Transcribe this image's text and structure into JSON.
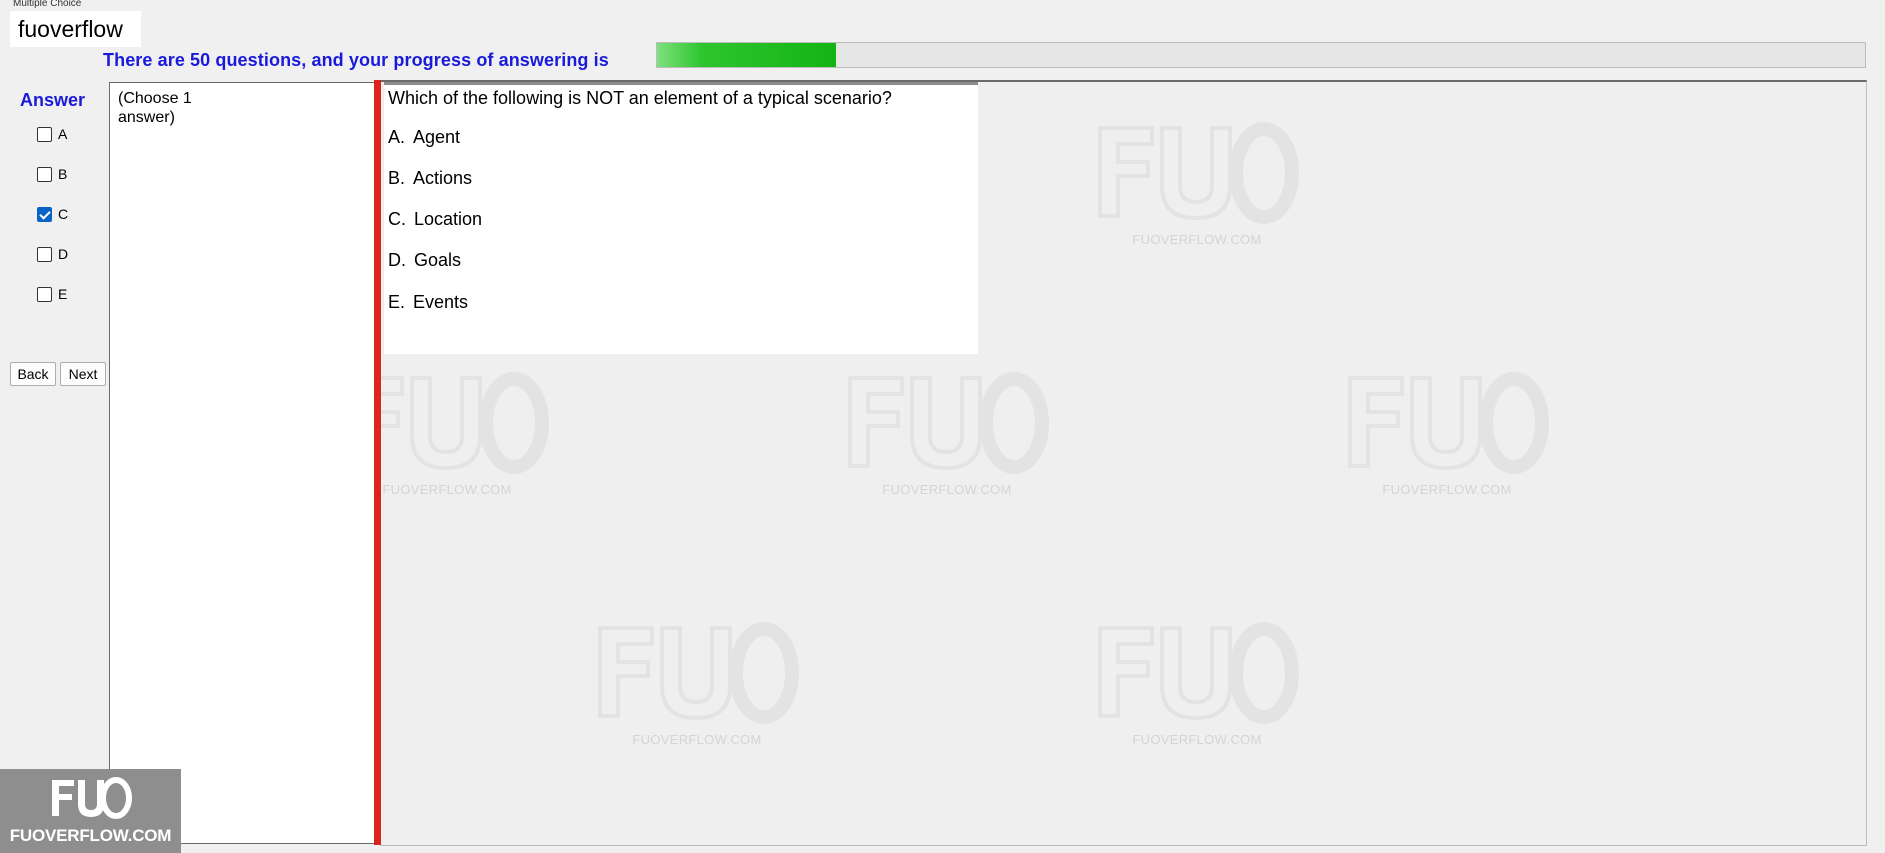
{
  "window": {
    "tab_title": "Multiple Choice",
    "brand": "fuoverflow"
  },
  "progress": {
    "text": "There are 50 questions, and your progress of answering is",
    "total_questions": 50,
    "fraction": 0.148
  },
  "answer_panel": {
    "title": "Answer",
    "options": [
      {
        "label": "A",
        "checked": false
      },
      {
        "label": "B",
        "checked": false
      },
      {
        "label": "C",
        "checked": true
      },
      {
        "label": "D",
        "checked": false
      },
      {
        "label": "E",
        "checked": false
      }
    ],
    "back_label": "Back",
    "next_label": "Next"
  },
  "instruction": "(Choose 1 answer)",
  "question": {
    "text": "Which of the following is NOT an element of a typical scenario?",
    "choices": [
      {
        "letter": "A.",
        "text": "Agent"
      },
      {
        "letter": "B.",
        "text": "Actions"
      },
      {
        "letter": "C.",
        "text": "Location"
      },
      {
        "letter": "D.",
        "text": "Goals"
      },
      {
        "letter": "E.",
        "text": "Events"
      }
    ]
  },
  "watermark": {
    "logo": "FUO",
    "caption": "FUOVERFLOW.COM"
  },
  "corner_logo": {
    "logo": "FUO",
    "caption": "FUOVERFLOW.COM"
  },
  "colors": {
    "accent_text": "#1a1adb",
    "progress_fill": "#14b414",
    "divider": "#d9261c",
    "checkbox_checked": "#0a64c8"
  }
}
